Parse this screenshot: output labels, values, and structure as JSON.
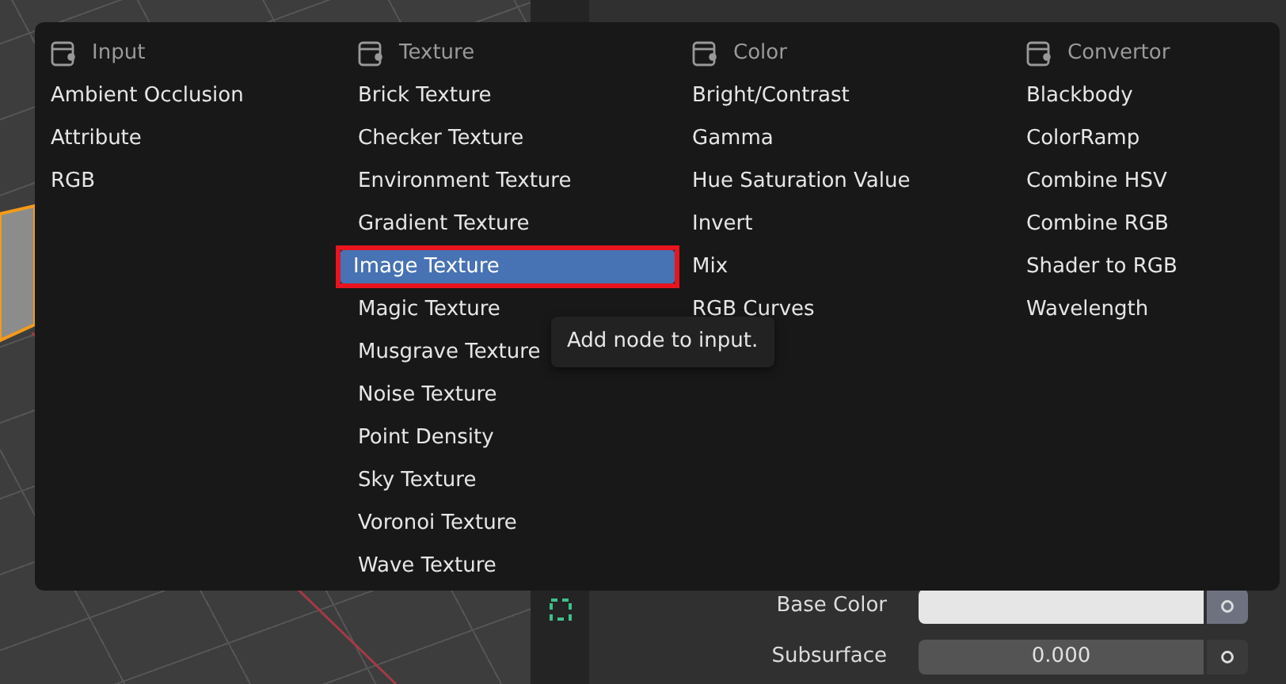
{
  "menu": {
    "columns": [
      {
        "title": "Input",
        "items": [
          {
            "label": "Ambient Occlusion",
            "selected": false
          },
          {
            "label": "Attribute",
            "selected": false
          },
          {
            "label": "RGB",
            "selected": false
          }
        ]
      },
      {
        "title": "Texture",
        "items": [
          {
            "label": "Brick Texture",
            "selected": false
          },
          {
            "label": "Checker Texture",
            "selected": false
          },
          {
            "label": "Environment Texture",
            "selected": false
          },
          {
            "label": "Gradient Texture",
            "selected": false
          },
          {
            "label": "Image Texture",
            "selected": true
          },
          {
            "label": "Magic Texture",
            "selected": false
          },
          {
            "label": "Musgrave Texture",
            "selected": false
          },
          {
            "label": "Noise Texture",
            "selected": false
          },
          {
            "label": "Point Density",
            "selected": false
          },
          {
            "label": "Sky Texture",
            "selected": false
          },
          {
            "label": "Voronoi Texture",
            "selected": false
          },
          {
            "label": "Wave Texture",
            "selected": false
          }
        ]
      },
      {
        "title": "Color",
        "items": [
          {
            "label": "Bright/Contrast",
            "selected": false
          },
          {
            "label": "Gamma",
            "selected": false
          },
          {
            "label": "Hue Saturation Value",
            "selected": false
          },
          {
            "label": "Invert",
            "selected": false
          },
          {
            "label": "Mix",
            "selected": false
          },
          {
            "label": "RGB Curves",
            "selected": false
          }
        ]
      },
      {
        "title": "Convertor",
        "items": [
          {
            "label": "Blackbody",
            "selected": false
          },
          {
            "label": "ColorRamp",
            "selected": false
          },
          {
            "label": "Combine HSV",
            "selected": false
          },
          {
            "label": "Combine RGB",
            "selected": false
          },
          {
            "label": "Shader to RGB",
            "selected": false
          },
          {
            "label": "Wavelength",
            "selected": false
          }
        ]
      }
    ]
  },
  "tooltip": "Add node to input.",
  "properties": {
    "fields": [
      {
        "label": "Base Color",
        "kind": "color",
        "color": "#e6e6e6"
      },
      {
        "label": "Subsurface",
        "kind": "number",
        "value": "0.000"
      }
    ]
  }
}
